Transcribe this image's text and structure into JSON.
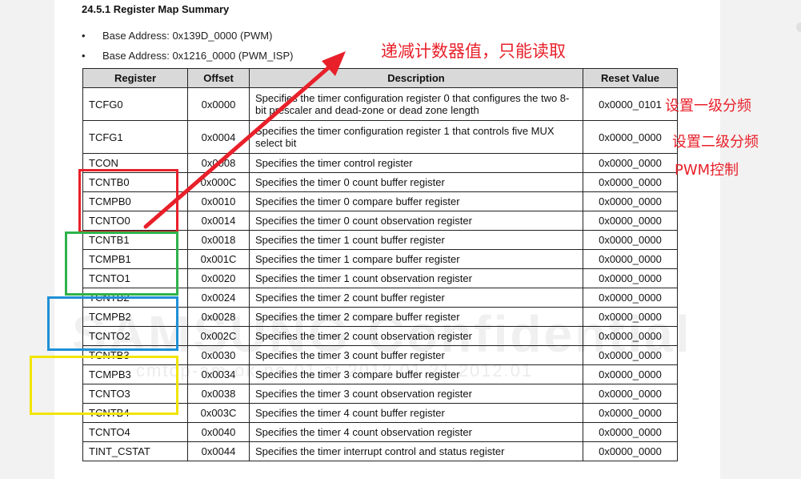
{
  "doc": {
    "heading": "24.5.1 Register Map Summary",
    "bullets": [
      "Base Address: 0x139D_0000 (PWM)",
      "Base Address: 0x1216_0000 (PWM_ISP)"
    ],
    "bullet_symbol": "•",
    "table": {
      "headers": [
        "Register",
        "Offset",
        "Description",
        "Reset Value"
      ],
      "rows": [
        [
          "TCFG0",
          "0x0000",
          "Specifies the timer configuration register 0 that configures the two 8-bit prescaler and dead-zone or dead zone length",
          "0x0000_0101"
        ],
        [
          "TCFG1",
          "0x0004",
          "Specifies the timer configuration register 1 that controls five MUX select bit",
          "0x0000_0000"
        ],
        [
          "TCON",
          "0x0008",
          "Specifies the timer control register",
          "0x0000_0000"
        ],
        [
          "TCNTB0",
          "0x000C",
          "Specifies the timer 0 count buffer register",
          "0x0000_0000"
        ],
        [
          "TCMPB0",
          "0x0010",
          "Specifies the timer 0 compare buffer register",
          "0x0000_0000"
        ],
        [
          "TCNTO0",
          "0x0014",
          "Specifies the timer 0 count observation register",
          "0x0000_0000"
        ],
        [
          "TCNTB1",
          "0x0018",
          "Specifies the timer 1 count buffer register",
          "0x0000_0000"
        ],
        [
          "TCMPB1",
          "0x001C",
          "Specifies the timer 1 compare buffer register",
          "0x0000_0000"
        ],
        [
          "TCNTO1",
          "0x0020",
          "Specifies the timer 1 count observation register",
          "0x0000_0000"
        ],
        [
          "TCNTB2",
          "0x0024",
          "Specifies the timer 2 count buffer register",
          "0x0000_0000"
        ],
        [
          "TCMPB2",
          "0x0028",
          "Specifies the timer 2 compare buffer register",
          "0x0000_0000"
        ],
        [
          "TCNTO2",
          "0x002C",
          "Specifies the timer 2 count observation register",
          "0x0000_0000"
        ],
        [
          "TCNTB3",
          "0x0030",
          "Specifies the timer 3 count buffer register",
          "0x0000_0000"
        ],
        [
          "TCMPB3",
          "0x0034",
          "Specifies the timer 3 compare buffer register",
          "0x0000_0000"
        ],
        [
          "TCNTO3",
          "0x0038",
          "Specifies the timer 3 count observation register",
          "0x0000_0000"
        ],
        [
          "TCNTB4",
          "0x003C",
          "Specifies the timer 4 count buffer register",
          "0x0000_0000"
        ],
        [
          "TCNTO4",
          "0x0040",
          "Specifies the timer 4 count observation register",
          "0x0000_0000"
        ],
        [
          "TINT_CSTAT",
          "0x0044",
          "Specifies the timer interrupt control and status register",
          "0x0000_0000"
        ]
      ]
    },
    "watermark": "SAMSUNG Confidential",
    "watermark_sub": "cmtop-am-ok-ne-01 at 2012.01.21,2012.01"
  },
  "annotations": {
    "arrow_note": "递减计数器值，只能读取",
    "tcfg0_note": "设置一级分频",
    "tcfg1_note": "设置二级分频",
    "tcon_note": "PWM控制",
    "color_red": "#e8202a",
    "box_colors": {
      "timer0": "#e8202a",
      "timer1": "#2eb24a",
      "timer2": "#1e90d6",
      "timer3": "#f2e400"
    }
  }
}
